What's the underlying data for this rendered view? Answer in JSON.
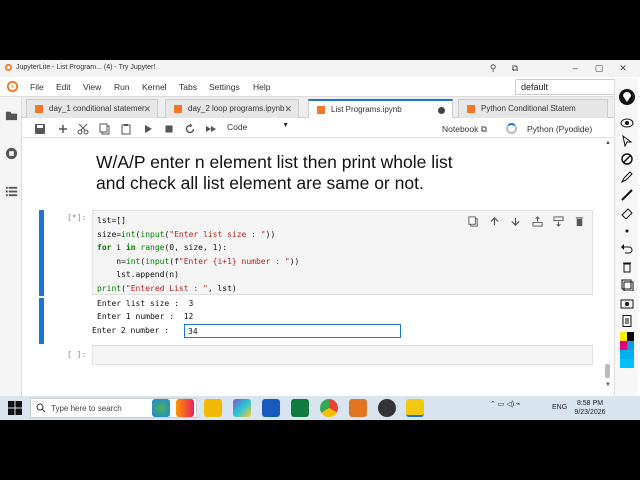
{
  "window": {
    "title": "JupyterLite - List Program... (4) - Try Jupyter!"
  },
  "menubar": {
    "items": [
      "File",
      "Edit",
      "View",
      "Run",
      "Kernel",
      "Tabs",
      "Settings",
      "Help"
    ],
    "kernel_select": "default"
  },
  "tabs": [
    {
      "label": "day_1 conditional statemer",
      "active": false,
      "dirty": false
    },
    {
      "label": "day_2 loop programs.ipynb",
      "active": false,
      "dirty": false
    },
    {
      "label": "List Programs.ipynb",
      "active": true,
      "dirty": true
    },
    {
      "label": "Python Conditional Statem",
      "active": false,
      "dirty": false
    }
  ],
  "toolbar": {
    "cell_type": "Code",
    "notebook_label": "Notebook",
    "kernel_name": "Python (Pyodide)"
  },
  "notebook": {
    "heading_line1": "W/A/P enter n element list then print whole list",
    "heading_line2": "and check all list element are same or not.",
    "cell1_prompt": "[*]:",
    "code_lines": [
      "lst=[]",
      "size=int(input(\"Enter list size : \"))",
      "for i in range(0, size, 1):",
      "    n=int(input(f\"Enter {i+1} number : \"))",
      "    lst.append(n)",
      "print(\"Entered List : \", lst)"
    ],
    "output_lines": [
      "Enter list size :  3",
      "Enter 1 number :  12"
    ],
    "stdin_prompt": "Enter 2 number : ",
    "stdin_value": "34",
    "cell2_prompt": "[ ]:"
  },
  "taskbar": {
    "search_placeholder": "Type here to search",
    "language": "ENG",
    "time": "8:58 PM",
    "date": "9/23/2026"
  },
  "colors": {
    "accent": "#1976d2",
    "taskbar": "#d9e4f1"
  }
}
